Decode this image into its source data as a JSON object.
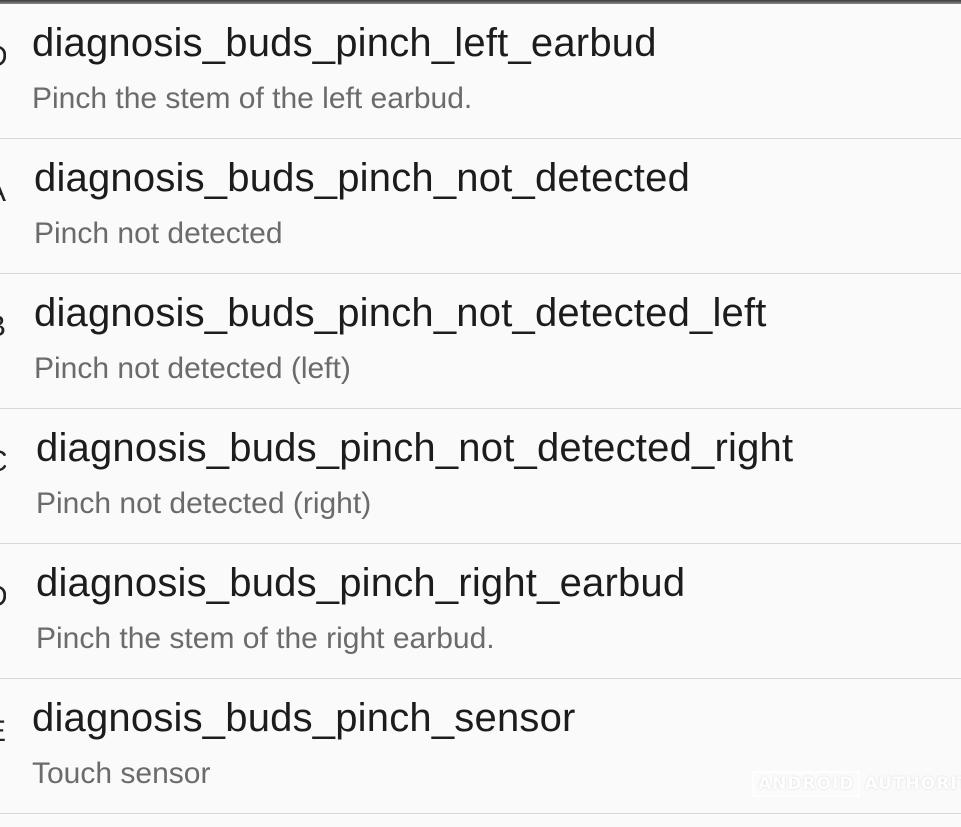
{
  "items": [
    {
      "left_letter": "D",
      "key": "diagnosis_buds_pinch_left_earbud",
      "description": "Pinch the stem of the left earbud."
    },
    {
      "left_letter": "A",
      "key": "diagnosis_buds_pinch_not_detected",
      "description": "Pinch not detected"
    },
    {
      "left_letter": "B",
      "key": "diagnosis_buds_pinch_not_detected_left",
      "description": "Pinch not detected (left)"
    },
    {
      "left_letter": "C",
      "key": "diagnosis_buds_pinch_not_detected_right",
      "description": "Pinch not detected (right)"
    },
    {
      "left_letter": "D",
      "key": "diagnosis_buds_pinch_right_earbud",
      "description": "Pinch the stem of the right earbud."
    },
    {
      "left_letter": "E",
      "key": "diagnosis_buds_pinch_sensor",
      "description": "Touch sensor"
    }
  ],
  "watermark": {
    "boxed": "ANDROID",
    "text": "AUTHORITY"
  }
}
